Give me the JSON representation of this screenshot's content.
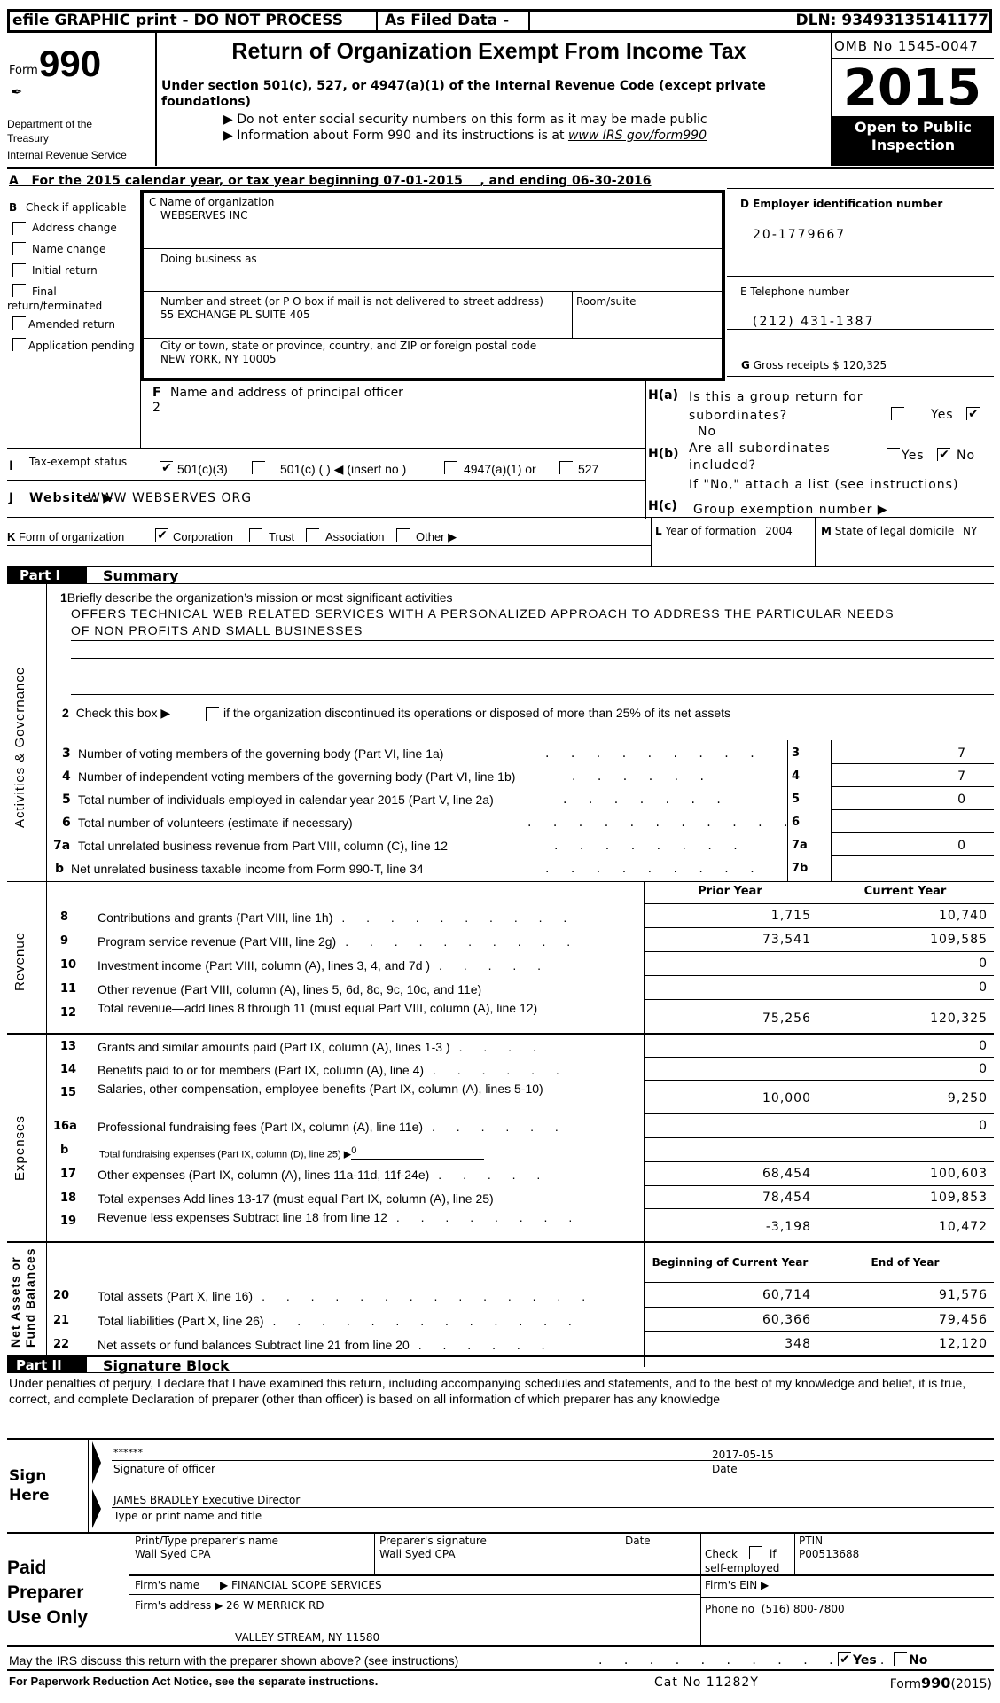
{
  "header": {
    "efile_label": "efile GRAPHIC print - DO NOT PROCESS",
    "as_filed_label": "As Filed Data -",
    "dln": "DLN: 93493135141177",
    "form_prefix": "Form",
    "form_number": "990",
    "department": "Department of the Treasury",
    "irs": "Internal Revenue Service",
    "title": "Return of Organization Exempt From Income Tax",
    "subtitle": "Under section 501(c), 527, or 4947(a)(1) of the Internal Revenue Code (except private foundations)",
    "note1": "▶ Do not enter social security numbers on this form as it may be made public",
    "note2_prefix": "▶ Information about Form 990 and its instructions is at ",
    "note2_link": "www IRS gov/form990",
    "omb": "OMB No 1545-0047",
    "year": "2015",
    "open_public": "Open to Public Inspection"
  },
  "section_a": {
    "text": "A   For the 2015 calendar year, or tax year beginning 07-01-2015    , and ending 06-30-2016"
  },
  "section_b": {
    "title_letter": "B",
    "title": "Check if applicable",
    "items": [
      {
        "label": "Address change",
        "checked": false
      },
      {
        "label": "Name change",
        "checked": false
      },
      {
        "label": "Initial return",
        "checked": false
      },
      {
        "label": "Final return/terminated",
        "checked": false
      },
      {
        "label": "Amended return",
        "checked": false
      },
      {
        "label": "Application pending",
        "checked": false
      }
    ]
  },
  "section_c": {
    "name_label": "C Name of organization",
    "name_value": "WEBSERVES INC",
    "dba_label": "Doing business as",
    "dba_value": "",
    "street_label": "Number and street (or P O  box if mail is not delivered to street address)",
    "street_value": "55 EXCHANGE PL SUITE 405",
    "room_label": "Room/suite",
    "room_value": "",
    "city_label": "City or town, state or province, country, and ZIP or foreign postal code",
    "city_value": "NEW YORK, NY  10005"
  },
  "section_d": {
    "label": "D Employer identification number",
    "value": "20-1779667"
  },
  "section_e": {
    "label": "E Telephone number",
    "value": "(212) 431-1387"
  },
  "section_g": {
    "letter": "G",
    "label": "Gross receipts $",
    "value": "120,325"
  },
  "section_f": {
    "letter": "F",
    "label": "Name and address of principal officer",
    "value": "2"
  },
  "section_h": {
    "ha_label": "H(a)",
    "ha_text": "Is this a group return for subordinates?",
    "ha_yes": "Yes",
    "ha_no": "No",
    "ha_yes_checked": false,
    "ha_no_checked": true,
    "hb_label": "H(b)",
    "hb_text": "Are all subordinates included?",
    "hb_yes": "Yes",
    "hb_no": "No",
    "hb_yes_checked": false,
    "hb_no_checked": true,
    "hb_note": "If \"No,\" attach a list  (see instructions)",
    "hc_label": "H(c)",
    "hc_text": "Group exemption number ▶"
  },
  "section_i": {
    "letter": "I",
    "label": "Tax-exempt status",
    "options": [
      {
        "label": "501(c)(3)",
        "checked": true
      },
      {
        "label": "501(c) (  ) ◀ (insert no )",
        "checked": false
      },
      {
        "label": "4947(a)(1) or",
        "checked": false
      },
      {
        "label": "527",
        "checked": false
      }
    ]
  },
  "section_j": {
    "letter": "J",
    "label": "Website: ▶",
    "value": "WWW WEBSERVES ORG"
  },
  "section_k": {
    "letter": "K",
    "label": "Form of organization",
    "options": [
      {
        "label": "Corporation",
        "checked": true
      },
      {
        "label": "Trust",
        "checked": false
      },
      {
        "label": "Association",
        "checked": false
      },
      {
        "label": "Other ▶",
        "checked": false
      }
    ]
  },
  "section_l": {
    "letter": "L",
    "label": "Year of formation",
    "value": "2004"
  },
  "section_m": {
    "letter": "M",
    "label": "State of legal domicile",
    "value": "NY"
  },
  "part1": {
    "part_label": "Part I",
    "title": "Summary",
    "side_labels": {
      "activities": "Activities & Governance",
      "revenue": "Revenue",
      "expenses": "Expenses",
      "net_assets_1": "Net Assets or",
      "net_assets_2": "Fund Balances"
    },
    "line1_num": "1",
    "line1_label": "Briefly describe the organization’s mission or most significant activities",
    "line1_value_1": "OFFERS TECHNICAL WEB RELATED SERVICES WITH A PERSONALIZED APPROACH TO ADDRESS THE PARTICULAR NEEDS",
    "line1_value_2": "OF NON PROFITS AND SMALL BUSINESSES",
    "line2_num": "2",
    "line2_pre": "Check this box ▶",
    "line2_post": "if the organization discontinued its operations or disposed of more than 25% of its net assets",
    "gov_lines": [
      {
        "num": "3",
        "label": "Number of voting members of the governing body (Part VI, line 1a)",
        "dots": ". . . . . . . . .",
        "box": "3",
        "value": "7"
      },
      {
        "num": "4",
        "label": "Number of independent voting members of the governing body (Part VI, line 1b)",
        "dots": ". . . . . .",
        "box": "4",
        "value": "7"
      },
      {
        "num": "5",
        "label": "Total number of individuals employed in calendar year 2015 (Part V, line 2a)",
        "dots": ". . . . . . .",
        "box": "5",
        "value": "0"
      },
      {
        "num": "6",
        "label": "Total number of volunteers (estimate if necessary)",
        "dots": ". . . . . . . . . . .",
        "box": "6",
        "value": ""
      },
      {
        "num": "7a",
        "label": "Total unrelated business revenue from Part VIII, column (C), line 12",
        "dots": ". . . . . . . .",
        "box": "7a",
        "value": "0"
      },
      {
        "num": "b",
        "label": "Net unrelated business taxable income from Form 990-T, line 34",
        "dots": ". . . . . . . . .",
        "box": "7b",
        "value": ""
      }
    ],
    "col_prior": "Prior Year",
    "col_current": "Current Year",
    "revenue_lines": [
      {
        "num": "8",
        "label": "Contributions and grants (Part VIII, line 1h)",
        "dots": ". . . . . . . . . .",
        "prior": "1,715",
        "current": "10,740"
      },
      {
        "num": "9",
        "label": "Program service revenue (Part VIII, line 2g)",
        "dots": ". . . . . . . . . .",
        "prior": "73,541",
        "current": "109,585"
      },
      {
        "num": "10",
        "label": "Investment income (Part VIII, column (A), lines 3, 4, and 7d )",
        "dots": ". . . . .",
        "prior": "",
        "current": "0"
      },
      {
        "num": "11",
        "label": "Other revenue (Part VIII, column (A), lines 5, 6d, 8c, 9c, 10c, and 11e)",
        "dots": "",
        "prior": "",
        "current": "0"
      },
      {
        "num": "12",
        "label": "Total revenue—add lines 8 through 11 (must equal Part VIII, column (A), line 12)",
        "dots": "",
        "prior": "75,256",
        "current": "120,325"
      }
    ],
    "expense_lines": [
      {
        "num": "13",
        "label": "Grants and similar amounts paid (Part IX, column (A), lines 1-3 )",
        "dots": ". . . .",
        "prior": "",
        "current": "0"
      },
      {
        "num": "14",
        "label": "Benefits paid to or for members (Part IX, column (A), line 4)",
        "dots": ". . . . . .",
        "prior": "",
        "current": "0"
      },
      {
        "num": "15",
        "label": "Salaries, other compensation, employee benefits (Part IX, column (A), lines 5-10)",
        "dots": "",
        "prior": "10,000",
        "current": "9,250"
      },
      {
        "num": "16a",
        "label": "Professional fundraising fees (Part IX, column (A), line 11e)",
        "dots": ". . . . . .",
        "prior": "",
        "current": "0"
      },
      {
        "num": "b",
        "label": "Total fundraising expenses (Part IX, column (D), line 25) ▶",
        "inline_value": "0",
        "dots": "",
        "prior": "",
        "current": ""
      },
      {
        "num": "17",
        "label": "Other expenses (Part IX, column (A), lines 11a-11d, 11f-24e)",
        "dots": ". . . . .",
        "prior": "68,454",
        "current": "100,603"
      },
      {
        "num": "18",
        "label": "Total expenses  Add lines 13-17 (must equal Part IX, column (A), line 25)",
        "dots": "",
        "prior": "78,454",
        "current": "109,853"
      },
      {
        "num": "19",
        "label": "Revenue less expenses  Subtract line 18 from line 12",
        "dots": ". . . . . . . .",
        "prior": "-3,198",
        "current": "10,472"
      }
    ],
    "col_begin": "Beginning of Current Year",
    "col_end": "End of Year",
    "net_lines": [
      {
        "num": "20",
        "label": "Total assets (Part X, line 16)",
        "dots": ". . . . . . . . . . . . . .",
        "begin": "60,714",
        "end": "91,576"
      },
      {
        "num": "21",
        "label": "Total liabilities (Part X, line 26)",
        "dots": ". . . . . . . . . . . . .",
        "begin": "60,366",
        "end": "79,456"
      },
      {
        "num": "22",
        "label": "Net assets or fund balances  Subtract line 21 from line 20",
        "dots": ". . . . . .",
        "begin": "348",
        "end": "12,120"
      }
    ]
  },
  "part2": {
    "part_label": "Part II",
    "title": "Signature Block",
    "declaration": "Under penalties of perjury, I declare that I have examined this return, including accompanying schedules and statements, and to the best of my knowledge and belief, it is true, correct, and complete  Declaration of preparer (other than officer) is based on all information of which preparer has any knowledge",
    "sign_here_1": "Sign",
    "sign_here_2": "Here",
    "officer_signature": "******",
    "signature_date": "2017-05-15",
    "signature_label": "Signature of officer",
    "date_label": "Date",
    "officer_name": "JAMES BRADLEY Executive Director",
    "name_label": "Type or print name and title"
  },
  "preparer": {
    "side_1": "Paid",
    "side_2": "Preparer",
    "side_3": "Use Only",
    "name_label": "Print/Type preparer's name",
    "name_value": "Wali Syed CPA",
    "sig_label": "Preparer's signature",
    "sig_value": "Wali Syed CPA",
    "date_label": "Date",
    "date_value": "",
    "check_label_1": "Check",
    "check_label_2": "if",
    "check_label_3": "self-employed",
    "self_employed_checked": false,
    "ptin_label": "PTIN",
    "ptin_value": "P00513688",
    "firm_name_label": "Firm's name",
    "firm_name_value": "▶ FINANCIAL SCOPE SERVICES",
    "firm_ein_label": "Firm's EIN ▶",
    "firm_ein_value": "",
    "firm_address_label": "Firm's address ▶",
    "firm_address_1": "26 W MERRICK RD",
    "firm_address_2": "VALLEY STREAM, NY  11580",
    "phone_label": "Phone no",
    "phone_value": "(516) 800-7800"
  },
  "discuss": {
    "question": "May the IRS discuss this return with the preparer shown above? (see instructions)",
    "dots": ". . . . . . . . . . . .",
    "yes": "Yes",
    "no": "No",
    "yes_checked": true,
    "no_checked": false
  },
  "footer": {
    "paperwork": "For Paperwork Reduction Act Notice, see the separate instructions.",
    "cat_no": "Cat No 11282Y",
    "form_prefix": "Form",
    "form_number": "990",
    "form_year": "(2015)"
  },
  "marks": {
    "check": "✔"
  }
}
